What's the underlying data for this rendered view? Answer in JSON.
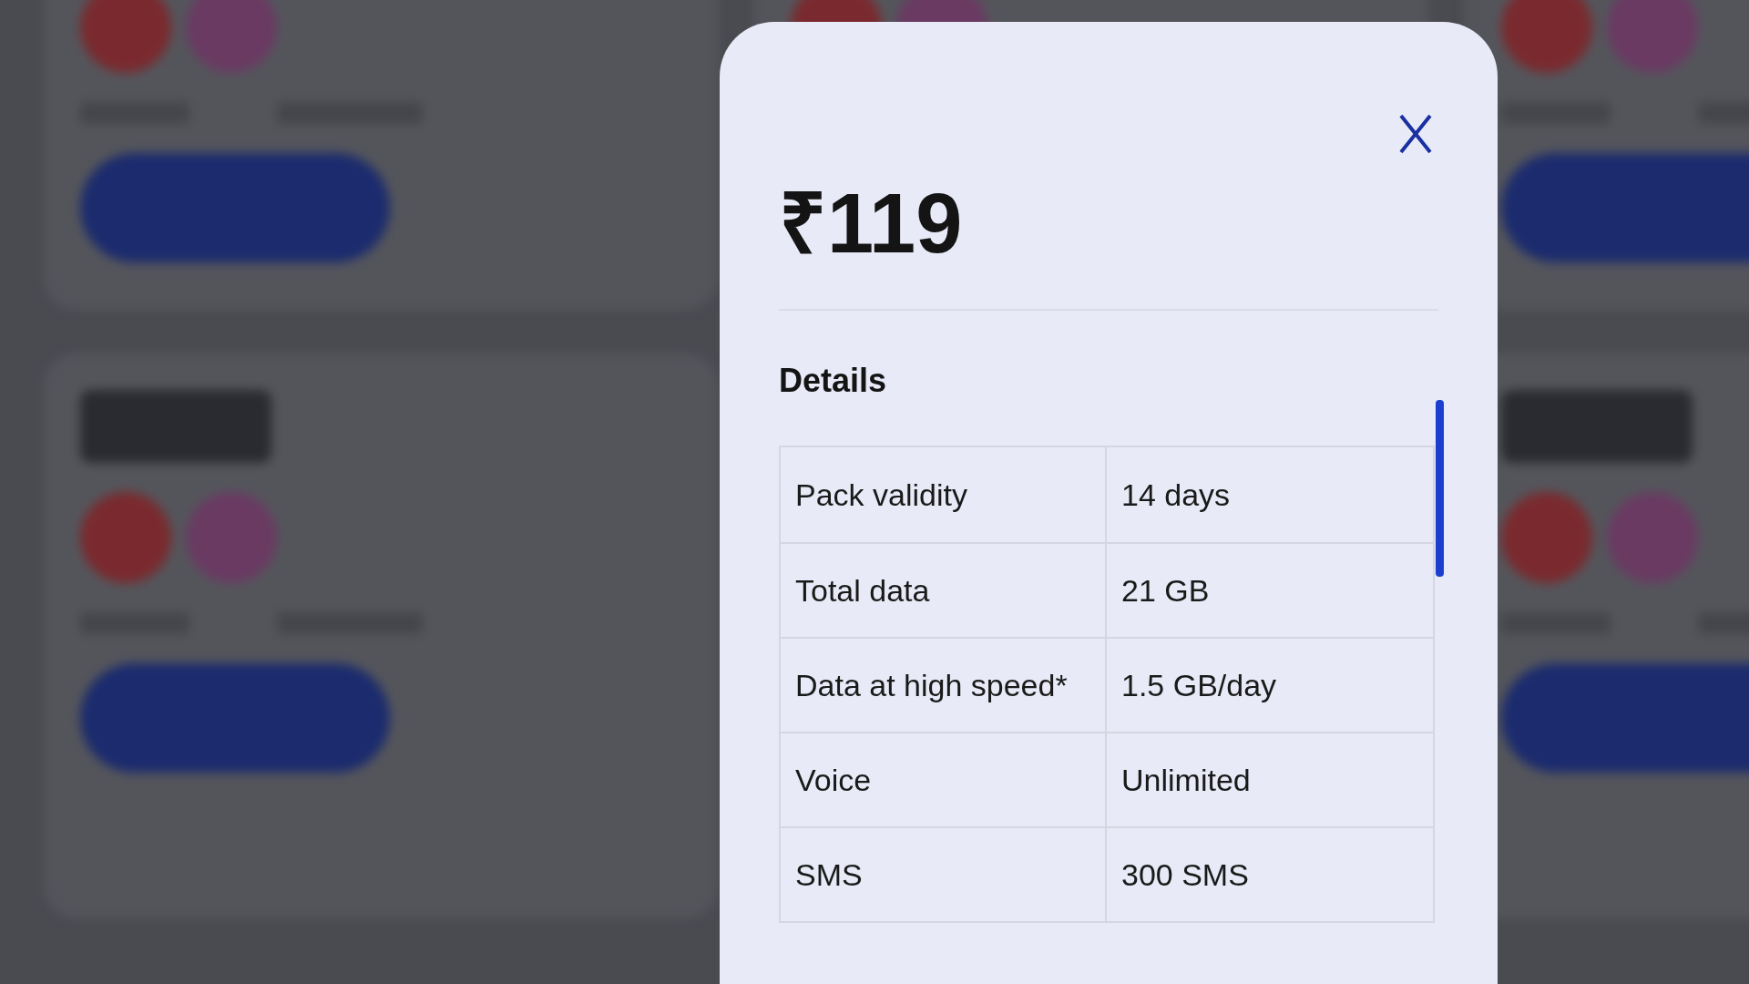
{
  "modal": {
    "price": "₹119",
    "section_title": "Details",
    "rows": [
      {
        "label": "Pack validity",
        "value": "14 days"
      },
      {
        "label": "Total data",
        "value": "21 GB"
      },
      {
        "label": "Data at high speed*",
        "value": "1.5 GB/day"
      },
      {
        "label": "Voice",
        "value": "Unlimited"
      },
      {
        "label": "SMS",
        "value": "300 SMS"
      }
    ]
  }
}
